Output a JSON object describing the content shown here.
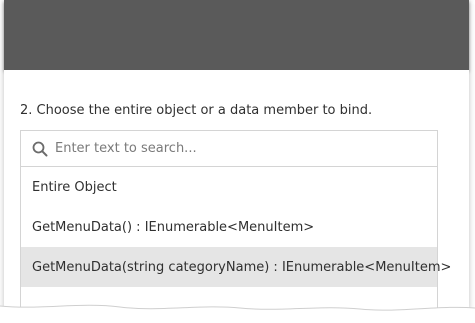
{
  "step": {
    "instruction": "2. Choose the entire object or a data member to bind."
  },
  "search": {
    "placeholder": "Enter text to search...",
    "value": ""
  },
  "members": [
    {
      "label": "Entire Object",
      "selected": false
    },
    {
      "label": "GetMenuData() : IEnumerable<MenuItem>",
      "selected": false
    },
    {
      "label": "GetMenuData(string categoryName) : IEnumerable<MenuItem>",
      "selected": true
    }
  ],
  "icons": {
    "search": "search-icon"
  },
  "colors": {
    "header": "#5a5a5a",
    "selected_row": "#e5e5e5",
    "border": "#d4d4d4",
    "text": "#303030"
  }
}
